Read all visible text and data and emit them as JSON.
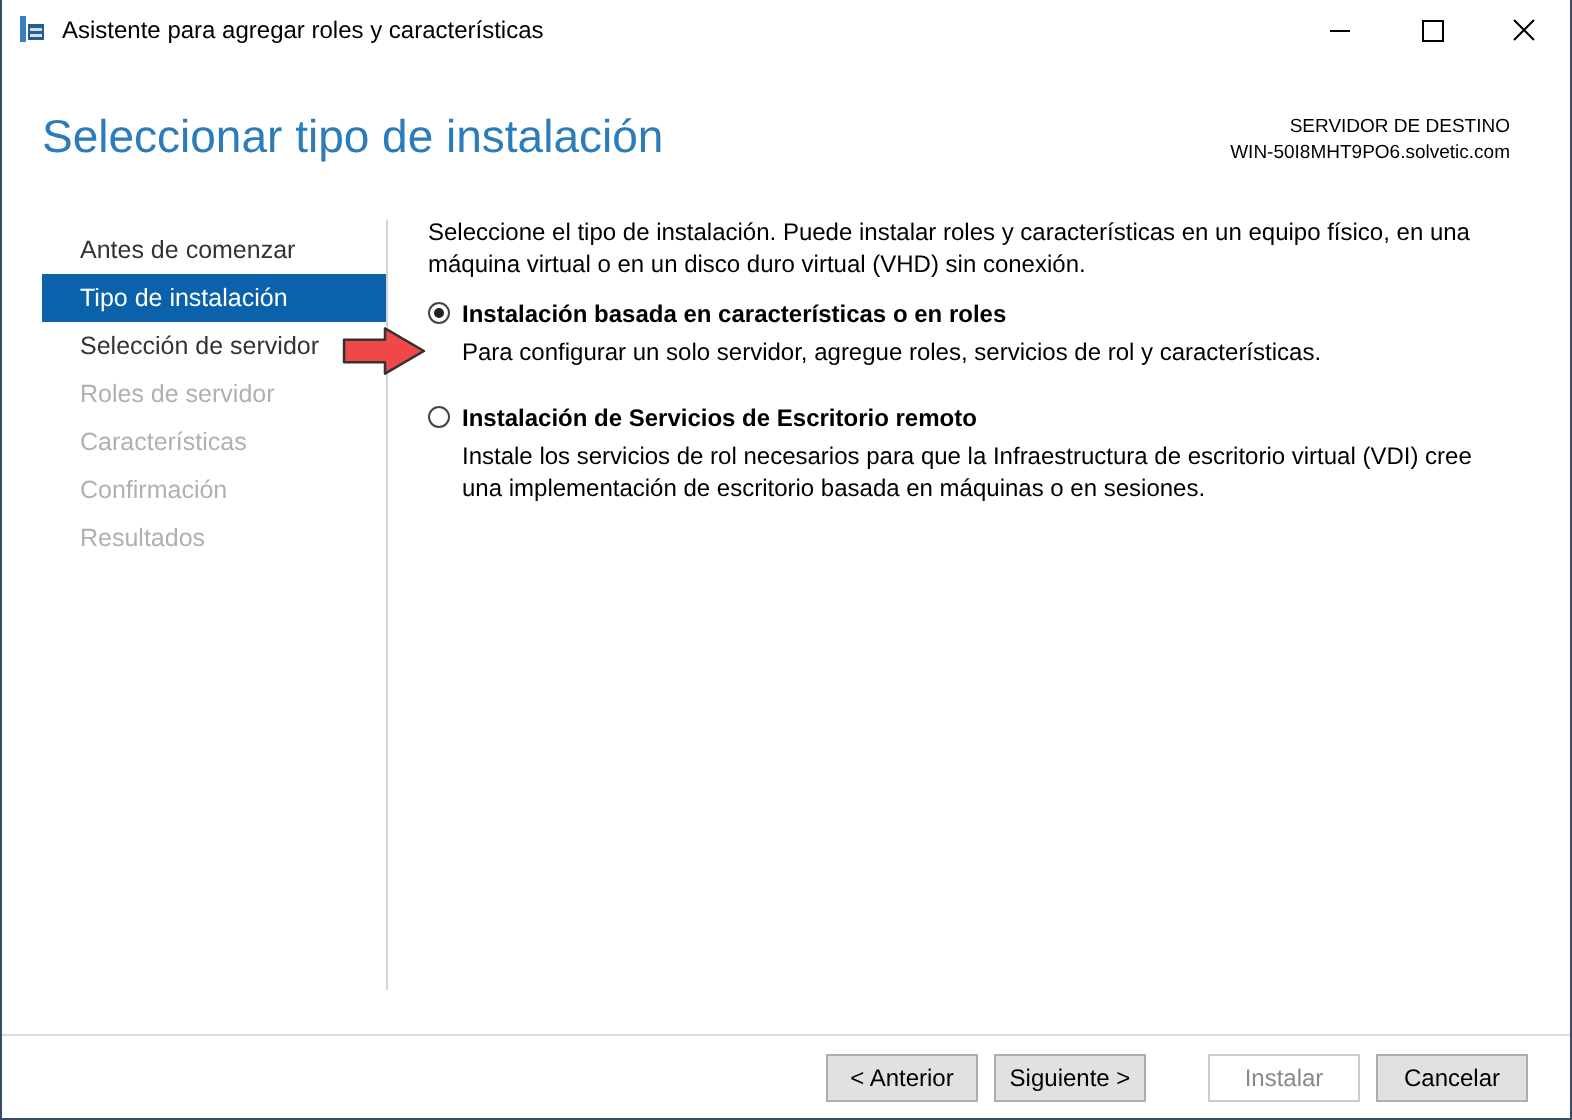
{
  "window": {
    "title": "Asistente para agregar roles y características"
  },
  "header": {
    "title": "Seleccionar tipo de instalación",
    "server_label": "SERVIDOR DE DESTINO",
    "server_name": "WIN-50I8MHT9PO6.solvetic.com"
  },
  "steps": [
    {
      "label": "Antes de comenzar",
      "selected": false,
      "disabled": false
    },
    {
      "label": "Tipo de instalación",
      "selected": true,
      "disabled": false
    },
    {
      "label": "Selección de servidor",
      "selected": false,
      "disabled": false
    },
    {
      "label": "Roles de servidor",
      "selected": false,
      "disabled": true
    },
    {
      "label": "Características",
      "selected": false,
      "disabled": true
    },
    {
      "label": "Confirmación",
      "selected": false,
      "disabled": true
    },
    {
      "label": "Resultados",
      "selected": false,
      "disabled": true
    }
  ],
  "intro": "Seleccione el tipo de instalación. Puede instalar roles y características en un equipo físico, en una máquina virtual o en un disco duro virtual (VHD) sin conexión.",
  "options": [
    {
      "label": "Instalación basada en características o en roles",
      "description": "Para configurar un solo servidor, agregue roles, servicios de rol y características.",
      "selected": true
    },
    {
      "label": "Instalación de Servicios de Escritorio remoto",
      "description": "Instale los servicios de rol necesarios para que la Infraestructura de escritorio virtual (VDI) cree una implementación de escritorio basada en máquinas o en sesiones.",
      "selected": false
    }
  ],
  "buttons": [
    {
      "label": "< Anterior",
      "disabled": false
    },
    {
      "label": "Siguiente >",
      "disabled": false
    },
    {
      "label": "Instalar",
      "disabled": true
    },
    {
      "label": "Cancelar",
      "disabled": false
    }
  ]
}
